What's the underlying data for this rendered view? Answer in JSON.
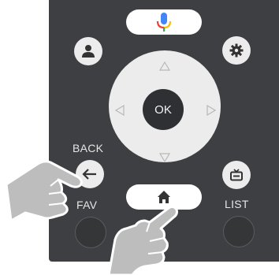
{
  "remote": {
    "ok_label": "OK",
    "back_label": "BACK",
    "fav_label": "FAV",
    "list_label": "LIST"
  },
  "icons": {
    "voice": "microphone-icon",
    "profile": "user-icon",
    "settings": "gear-icon",
    "back": "back-arrow-icon",
    "tv": "tv-icon",
    "home": "home-icon"
  },
  "colors": {
    "body": "#3e3f42",
    "button": "#ececec",
    "mic_blue": "#4285f4",
    "mic_red": "#ea4335",
    "mic_yellow": "#fbbc05",
    "mic_green": "#34a853",
    "hand": "#bdbdbd"
  }
}
